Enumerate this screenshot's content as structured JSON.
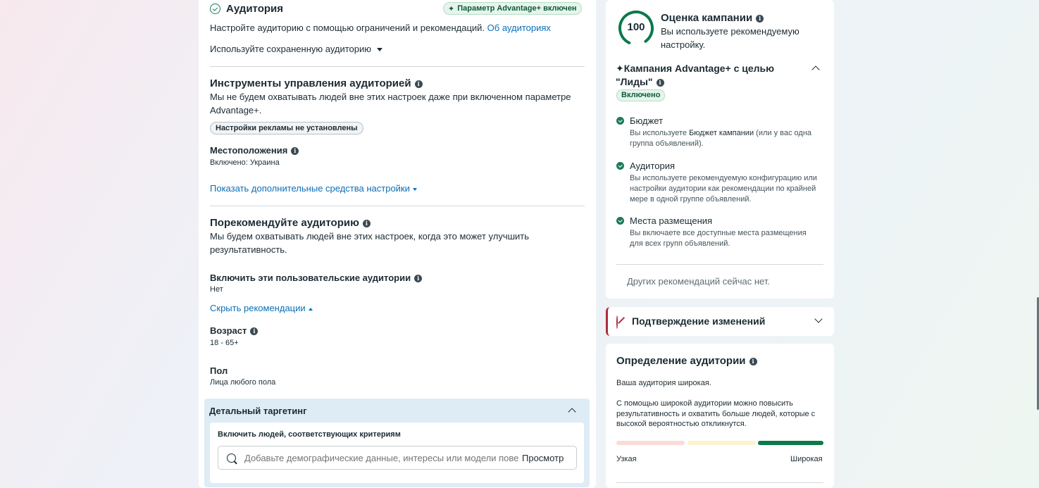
{
  "audience": {
    "title": "Аудитория",
    "advantage_badge": "Параметр Advantage+ включен",
    "description": "Настройте аудиторию с помощью ограничений и рекомендаций.",
    "about_link": "Об аудиториях",
    "saved_audience": "Используйте сохраненную аудиторию"
  },
  "controls": {
    "title": "Инструменты управления аудиторией",
    "description": "Мы не будем охватывать людей вне этих настроек даже при включенном параметре Advantage+.",
    "ad_settings_pill": "Настройки рекламы не установлены",
    "locations_label": "Местоположения",
    "locations_value": "Включено: Украина",
    "more_options_link": "Показать дополнительные средства настройки"
  },
  "suggest": {
    "title": "Порекомендуйте аудиторию",
    "description": "Мы будем охватывать людей вне этих настроек, когда это может улучшить результативность.",
    "custom_label": "Включить эти пользовательские аудитории",
    "custom_value": "Нет",
    "hide_link": "Скрыть рекомендации",
    "age_label": "Возраст",
    "age_value": "18 - 65+",
    "gender_label": "Пол",
    "gender_value": "Лица любого пола"
  },
  "detailed": {
    "title": "Детальный таргетинг",
    "include_label": "Включить людей, соответствующих критериям",
    "search_placeholder": "Добавьте демографические данные, интересы или модели пове,",
    "browse_label": "Просмотр"
  },
  "score": {
    "value": "100",
    "title": "Оценка кампании",
    "description": "Вы используете рекомендуемую настройку.",
    "campaign_title": "Кампания Advantage+ с целью \"Лиды\"",
    "enabled_pill": "Включено",
    "items": [
      {
        "title": "Бюджет",
        "desc_prefix": "Вы используете ",
        "desc_bold": "Бюджет кампании",
        "desc_suffix": " (или у вас одна группа объявлений)."
      },
      {
        "title": "Аудитория",
        "desc": "Вы используете рекомендуемую конфигурацию или настройки аудитории как рекомендации по крайней мере в одной группе объявлений."
      },
      {
        "title": "Места размещения",
        "desc": "Вы включаете все доступные места размещения для всех групп объявлений."
      }
    ],
    "no_more": "Других рекомендаций сейчас нет."
  },
  "confirm": {
    "title": "Подтверждение изменений"
  },
  "definition": {
    "title": "Определение аудитории",
    "status": "Ваша аудитория широкая.",
    "description": "С помощью широкой аудитории можно повысить результативность и охватить больше людей, которые с высокой вероятностью откликнутся.",
    "narrow": "Узкая",
    "wide": "Широкая",
    "level": "wide",
    "colors": {
      "narrow": "#fadbd8",
      "mid": "#fcf3cf",
      "wide": "#0b7a4b"
    }
  }
}
